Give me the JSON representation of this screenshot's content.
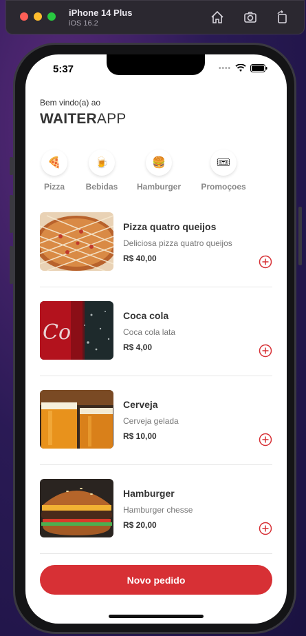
{
  "simulator": {
    "device_name": "iPhone 14 Plus",
    "os_version": "iOS 16.2",
    "toolbar": [
      "home-icon",
      "screenshot-icon",
      "rotate-icon"
    ]
  },
  "status_bar": {
    "time": "5:37"
  },
  "header": {
    "greeting": "Bem vindo(a) ao",
    "brand_bold": "WAITER",
    "brand_light": "APP"
  },
  "categories": [
    {
      "label": "Pizza",
      "icon": "pizza-icon",
      "emoji": "🍕"
    },
    {
      "label": "Bebidas",
      "icon": "beer-icon",
      "emoji": "🍺"
    },
    {
      "label": "Hamburger",
      "icon": "burger-icon",
      "emoji": "🍔"
    },
    {
      "label": "Promoçoes",
      "icon": "ticket-icon",
      "emoji": "🎟"
    }
  ],
  "products": [
    {
      "name": "Pizza quatro queijos",
      "description": "Deliciosa pizza quatro queijos",
      "price": "R$ 40,00",
      "image": "pizza"
    },
    {
      "name": "Coca cola",
      "description": "Coca cola lata",
      "price": "R$ 4,00",
      "image": "coca-cola"
    },
    {
      "name": "Cerveja",
      "description": "Cerveja gelada",
      "price": "R$ 10,00",
      "image": "beer"
    },
    {
      "name": "Hamburger",
      "description": "Hamburger chesse",
      "price": "R$ 20,00",
      "image": "burger"
    }
  ],
  "cta": {
    "label": "Novo pedido"
  },
  "colors": {
    "accent": "#D73035",
    "text": "#333333",
    "muted": "#888888"
  }
}
